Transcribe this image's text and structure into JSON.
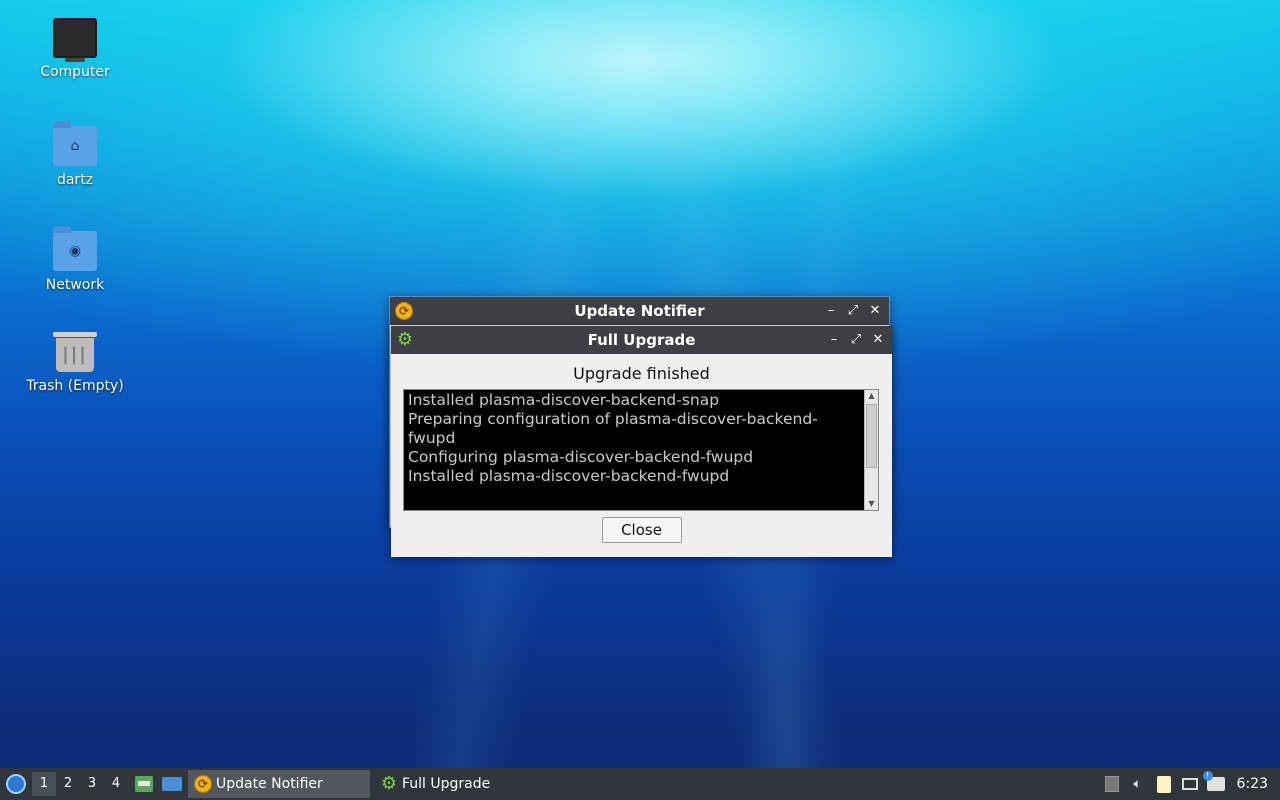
{
  "desktop": {
    "icons": [
      {
        "label": "Computer"
      },
      {
        "label": "dartz"
      },
      {
        "label": "Network"
      },
      {
        "label": "Trash (Empty)"
      }
    ]
  },
  "notifier_window": {
    "title": "Update Notifier",
    "icon": "update-notifier-icon",
    "controls": {
      "minimize": "–",
      "maximize": "⤢",
      "close": "✕"
    }
  },
  "upgrade_window": {
    "title": "Full Upgrade",
    "icon": "gear-icon",
    "controls": {
      "minimize": "–",
      "maximize": "⤢",
      "close": "✕"
    },
    "status": "Upgrade finished",
    "log_lines": [
      "Installed plasma-discover-backend-snap",
      "Preparing configuration of plasma-discover-backend-fwupd",
      "Configuring plasma-discover-backend-fwupd",
      "Installed plasma-discover-backend-fwupd"
    ],
    "close_label": "Close"
  },
  "taskbar": {
    "workspaces": [
      "1",
      "2",
      "3",
      "4"
    ],
    "active_workspace": "1",
    "tasks": [
      {
        "label": "Update Notifier",
        "icon": "update-notifier-icon",
        "active": true
      },
      {
        "label": "Full Upgrade",
        "icon": "gear-icon",
        "active": false
      }
    ],
    "clock": "6:23"
  }
}
